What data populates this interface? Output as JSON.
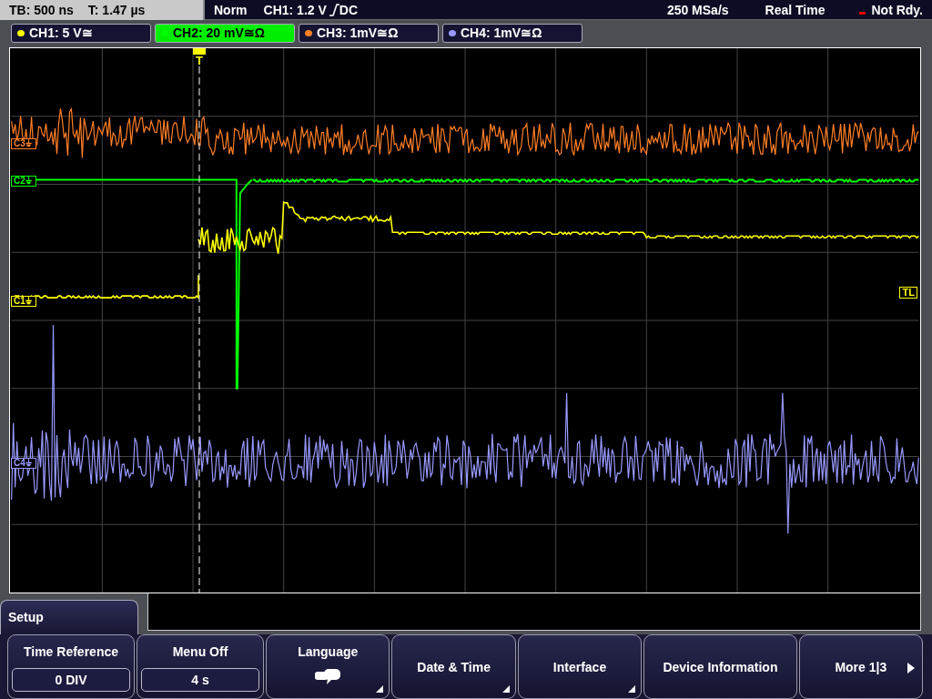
{
  "status_bar": {
    "timebase": "TB: 500 ns",
    "trigger_time": "T: 1.47 µs",
    "mode": "Norm",
    "trigger": {
      "label": "CH1: 1.2 V",
      "coupling": "DC"
    },
    "sample_rate": "250 MSa/s",
    "acquisition": "Real Time",
    "state": "Not Rdy."
  },
  "channels": [
    {
      "label": "CH1: 5 V≅",
      "color": "#ffff00",
      "selected": false
    },
    {
      "label": "CH2: 20 mV≅Ω",
      "color": "#00ff00",
      "selected": true
    },
    {
      "label": "CH3: 1mV≅Ω",
      "color": "#ff7f27",
      "selected": false
    },
    {
      "label": "CH4: 1mV≅Ω",
      "color": "#9999ff",
      "selected": false
    }
  ],
  "markers": [
    {
      "label": "C3⏚",
      "color": "#ff7f27"
    },
    {
      "label": "C2⏚",
      "color": "#00ff00"
    },
    {
      "label": "C1⏚",
      "color": "#ffff00"
    },
    {
      "label": "C4⏚",
      "color": "#9999ff"
    }
  ],
  "trigger_marker": "T",
  "trigger_level_marker": "TL",
  "menu": {
    "title": "Setup"
  },
  "softkeys": [
    {
      "kind": "value",
      "label": "Time Reference",
      "value": "0 DIV"
    },
    {
      "kind": "value",
      "label": "Menu Off",
      "value": "4 s"
    },
    {
      "kind": "icon",
      "label": "Language"
    },
    {
      "kind": "submenu",
      "label": "Date & Time"
    },
    {
      "kind": "submenu",
      "label": "Interface"
    },
    {
      "kind": "plain",
      "label": "Device Information"
    },
    {
      "kind": "more",
      "label": "More 1|3"
    }
  ]
}
